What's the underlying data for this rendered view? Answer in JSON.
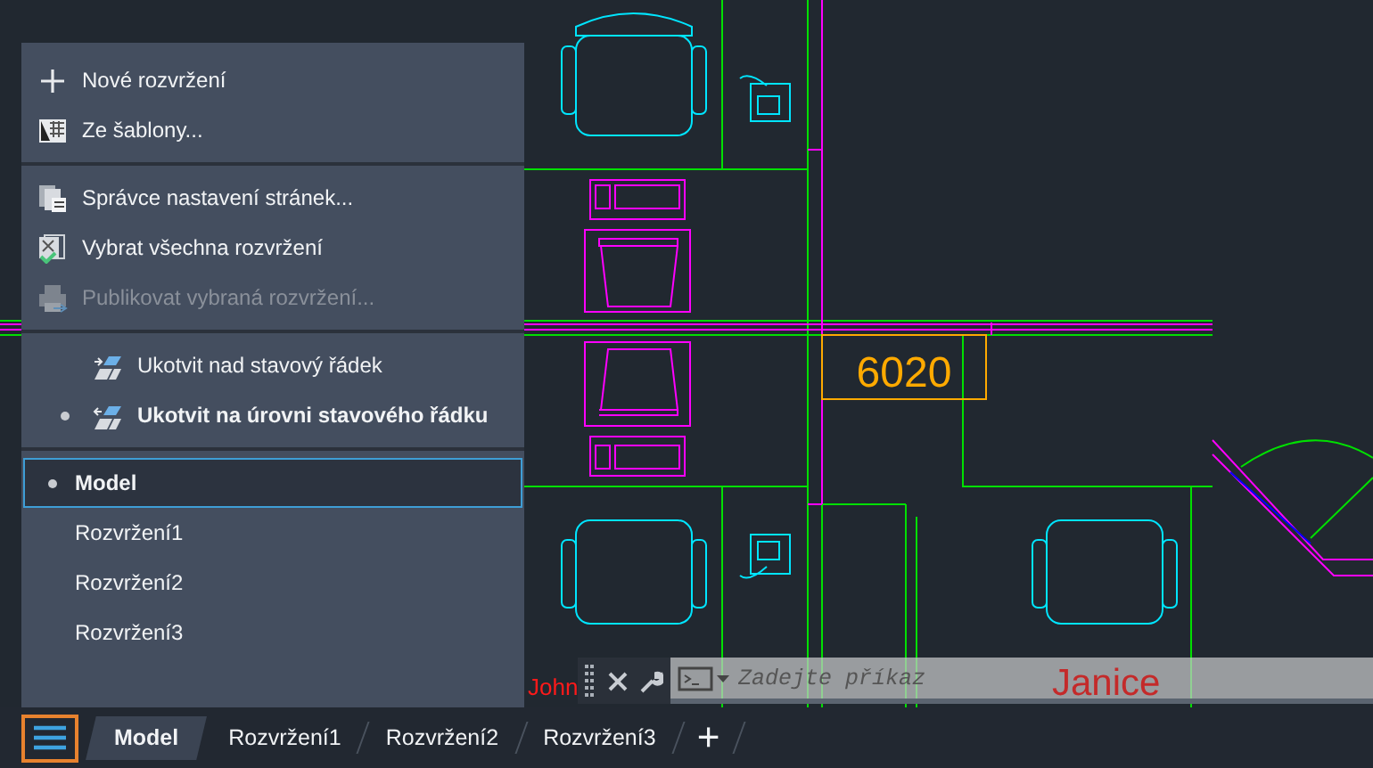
{
  "drawing": {
    "labels": [
      {
        "text": "6020",
        "kind": "room"
      },
      {
        "text": "John",
        "kind": "name"
      },
      {
        "text": "Janice",
        "kind": "faded-name"
      }
    ]
  },
  "layout_menu": {
    "sections": [
      {
        "kind": "commands",
        "items": [
          {
            "kind": "new",
            "label": "Nové rozvržení",
            "disabled": false
          },
          {
            "kind": "template",
            "label": "Ze šablony...",
            "disabled": false
          }
        ]
      },
      {
        "kind": "commands",
        "items": [
          {
            "kind": "page-setup",
            "label": "Správce nastavení stránek...",
            "disabled": false
          },
          {
            "kind": "select-all",
            "label": "Vybrat všechna rozvržení",
            "disabled": false
          },
          {
            "kind": "publish",
            "label": "Publikovat vybraná rozvržení...",
            "disabled": true
          }
        ]
      },
      {
        "kind": "dock",
        "items": [
          {
            "kind": "dock-above",
            "label": "Ukotvit nad stavový řádek",
            "selected": false
          },
          {
            "kind": "dock-inline",
            "label": "Ukotvit na úrovni stavového řádku",
            "selected": true
          }
        ]
      },
      {
        "kind": "layouts",
        "items": [
          {
            "label": "Model",
            "selected": true
          },
          {
            "label": "Rozvržení1",
            "selected": false
          },
          {
            "label": "Rozvržení2",
            "selected": false
          },
          {
            "label": "Rozvržení3",
            "selected": false
          }
        ]
      }
    ]
  },
  "command_line": {
    "placeholder": "Zadejte příkaz"
  },
  "status_bar": {
    "menu_button": {
      "active": true
    },
    "tabs": [
      {
        "label": "Model",
        "selected": true
      },
      {
        "label": "Rozvržení1",
        "selected": false
      },
      {
        "label": "Rozvržení2",
        "selected": false
      },
      {
        "label": "Rozvržení3",
        "selected": false
      }
    ],
    "add_tab": "+"
  }
}
